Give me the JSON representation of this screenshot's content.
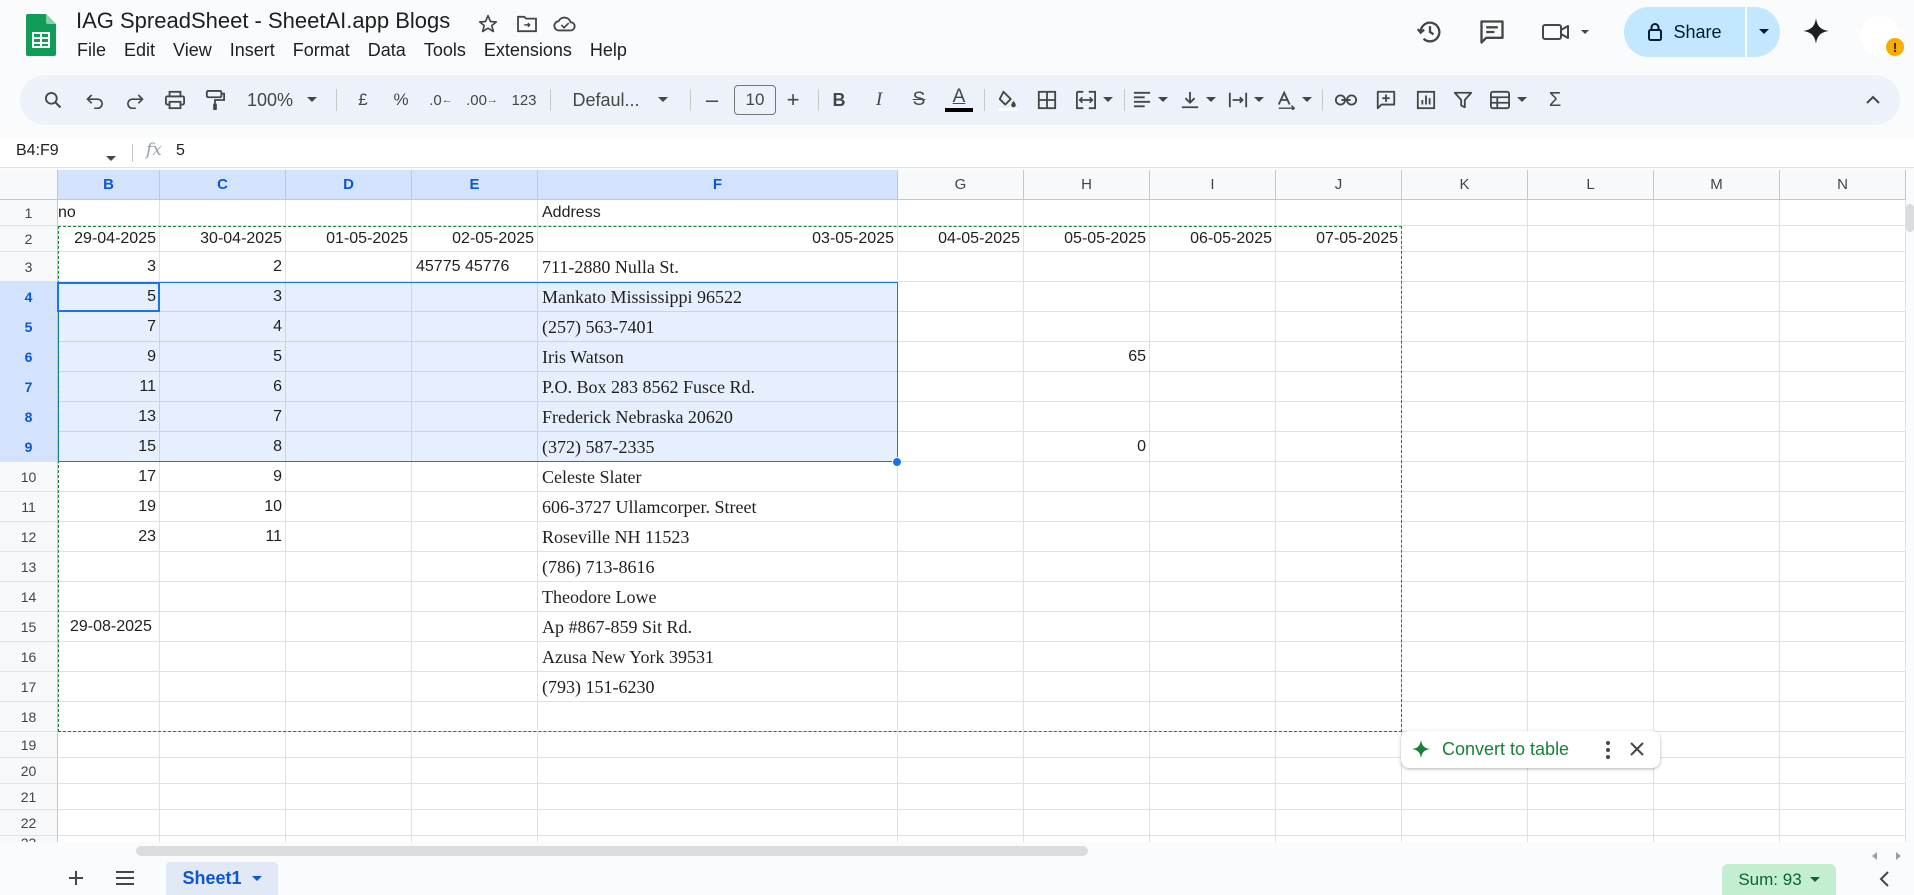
{
  "doc": {
    "title": "IAG SpreadSheet - SheetAI.app Blogs"
  },
  "menu": [
    "File",
    "Edit",
    "View",
    "Insert",
    "Format",
    "Data",
    "Tools",
    "Extensions",
    "Help"
  ],
  "share": {
    "label": "Share"
  },
  "toolbar": {
    "zoom": "100%",
    "currency": "£",
    "percent": "%",
    "dec_decrease": ".0",
    "dec_increase": ".00",
    "number_format": "123",
    "font": "Defaul...",
    "font_size": "10",
    "minus": "–",
    "plus": "+",
    "bold": "B",
    "italic": "I",
    "strike": "S",
    "text_color": "A",
    "sigma": "Σ"
  },
  "formula_bar": {
    "name_box": "B4:F9",
    "fx": "fx",
    "value": "5"
  },
  "columns": [
    "B",
    "C",
    "D",
    "E",
    "F",
    "G",
    "H",
    "I",
    "J",
    "K",
    "L",
    "M",
    "N"
  ],
  "rows": [
    "1",
    "2",
    "3",
    "4",
    "5",
    "6",
    "7",
    "8",
    "9",
    "10",
    "11",
    "12",
    "13",
    "14",
    "15",
    "16",
    "17",
    "18",
    "19",
    "20",
    "21",
    "22",
    "23"
  ],
  "cells": {
    "B1": "no",
    "F1": "Address",
    "B2": "29-04-2025",
    "C2": "30-04-2025",
    "D2": "01-05-2025",
    "E2": "02-05-2025",
    "F2": "03-05-2025",
    "G2": "04-05-2025",
    "H2": "05-05-2025",
    "I2": "06-05-2025",
    "J2": "07-05-2025",
    "B3": "3",
    "C3": "2",
    "E3": "45775 45776",
    "F3": "711-2880 Nulla St.",
    "B4": "5",
    "C4": "3",
    "F4": "Mankato Mississippi 96522",
    "B5": "7",
    "C5": "4",
    "F5": "(257) 563-7401",
    "B6": "9",
    "C6": "5",
    "F6": "Iris Watson",
    "H6": "65",
    "B7": "11",
    "C7": "6",
    "F7": "P.O. Box 283 8562 Fusce Rd.",
    "B8": "13",
    "C8": "7",
    "F8": "Frederick Nebraska 20620",
    "B9": "15",
    "C9": "8",
    "F9": "(372) 587-2335",
    "H9": "0",
    "B10": "17",
    "C10": "9",
    "F10": "Celeste Slater",
    "B11": "19",
    "C11": "10",
    "F11": "606-3727 Ullamcorper. Street",
    "B12": "23",
    "C12": "11",
    "F12": "Roseville NH 11523",
    "F13": "(786) 713-8616",
    "F14": "Theodore Lowe",
    "B15": "29-08-2025",
    "F15": "Ap #867-859 Sit Rd.",
    "F16": "Azusa New York 39531",
    "F17": "(793) 151-6230"
  },
  "convert_chip": {
    "label": "Convert to table"
  },
  "sheet_tab": {
    "label": "Sheet1"
  },
  "sum": {
    "label": "Sum: 93"
  },
  "colors": {
    "accent": "#1a73e8",
    "selection_fill": "#e8f0fe",
    "share_bg": "#c2e7ff",
    "chip_green": "#188038",
    "sum_bg": "#c4eed0"
  }
}
